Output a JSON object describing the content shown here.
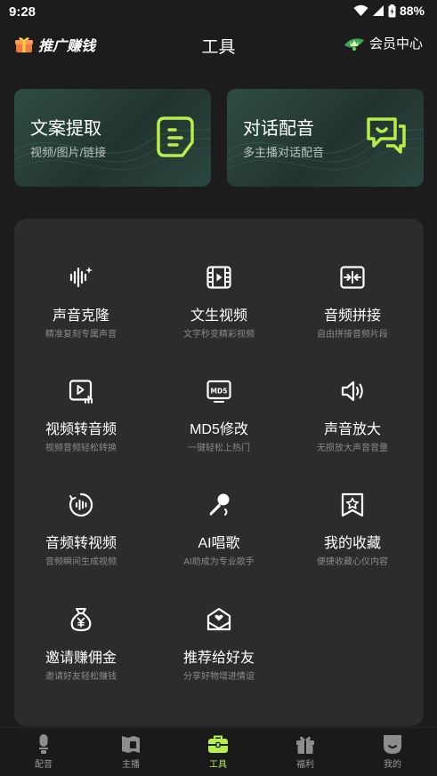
{
  "status_bar": {
    "time": "9:28",
    "battery": "88%"
  },
  "header": {
    "promo_label": "推广赚钱",
    "title": "工具",
    "vip_label": "会员中心"
  },
  "feature_cards": [
    {
      "title": "文案提取",
      "subtitle": "视频/图片/链接",
      "icon": "document-icon"
    },
    {
      "title": "对话配音",
      "subtitle": "多主播对话配音",
      "icon": "chat-bubbles-icon"
    }
  ],
  "tools": [
    {
      "name": "声音克隆",
      "desc": "精准复刻专属声音",
      "icon": "sound-wave-icon"
    },
    {
      "name": "文生视频",
      "desc": "文字秒变精彩视频",
      "icon": "film-play-icon"
    },
    {
      "name": "音频拼接",
      "desc": "自由拼接音频片段",
      "icon": "merge-arrows-icon"
    },
    {
      "name": "视频转音频",
      "desc": "视频音频轻松转换",
      "icon": "video-to-audio-icon"
    },
    {
      "name": "MD5修改",
      "desc": "一键轻松上热门",
      "icon": "md5-icon"
    },
    {
      "name": "声音放大",
      "desc": "无损放大声音音量",
      "icon": "speaker-icon"
    },
    {
      "name": "音频转视频",
      "desc": "音频瞬间生成视频",
      "icon": "audio-circle-icon"
    },
    {
      "name": "AI唱歌",
      "desc": "AI助成为专业歌手",
      "icon": "microphone-icon"
    },
    {
      "name": "我的收藏",
      "desc": "便捷收藏心仪内容",
      "icon": "bookmark-star-icon"
    },
    {
      "name": "邀请赚佣金",
      "desc": "邀请好友轻松赚钱",
      "icon": "money-bag-icon"
    },
    {
      "name": "推荐给好友",
      "desc": "分享好物增进情谊",
      "icon": "envelope-heart-icon"
    }
  ],
  "bottom_nav": [
    {
      "label": "配音",
      "icon": "mic-nav-icon",
      "active": false
    },
    {
      "label": "主播",
      "icon": "anchor-nav-icon",
      "active": false
    },
    {
      "label": "工具",
      "icon": "toolbox-nav-icon",
      "active": true
    },
    {
      "label": "福利",
      "icon": "gift-nav-icon",
      "active": false
    },
    {
      "label": "我的",
      "icon": "profile-nav-icon",
      "active": false
    }
  ],
  "colors": {
    "accent": "#b6ee4a",
    "background": "#1c1c1c",
    "panel": "#2c2c2c",
    "card": "#27403a"
  }
}
